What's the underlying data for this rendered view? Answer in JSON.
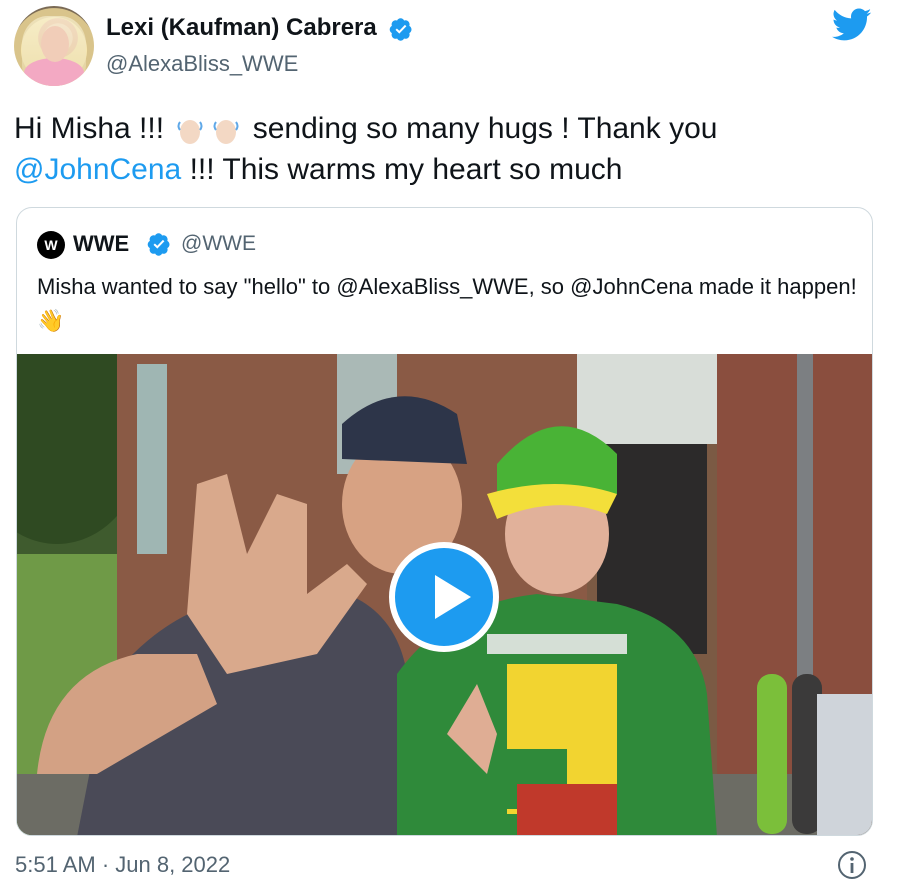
{
  "author": {
    "name": "Lexi (Kaufman) Cabrera",
    "handle": "@AlexaBliss_WWE",
    "avatar_icon": "profile-photo",
    "verified_icon": "verified-badge-icon"
  },
  "tweet": {
    "text_part1": "Hi Misha !!! ",
    "text_part2": " sending so many hugs ! Thank you ",
    "mention": "@JohnCena",
    "text_part3": " !!! This warms my heart so much"
  },
  "quoted_tweet": {
    "name": "WWE",
    "handle": "@WWE",
    "logo_text": "W",
    "text": "Misha wanted to say \"hello\" to @AlexaBliss_WWE, so @JohnCena made it happen! 👋"
  },
  "media": {
    "type": "video",
    "play_icon": "play-icon"
  },
  "footer": {
    "timestamp": "5:51 AM · Jun 8, 2022",
    "info_icon": "info-icon"
  },
  "colors": {
    "accent": "#1d9bf0",
    "text": "#0f1419",
    "secondary_text": "#536471",
    "border": "#cfd9de"
  }
}
